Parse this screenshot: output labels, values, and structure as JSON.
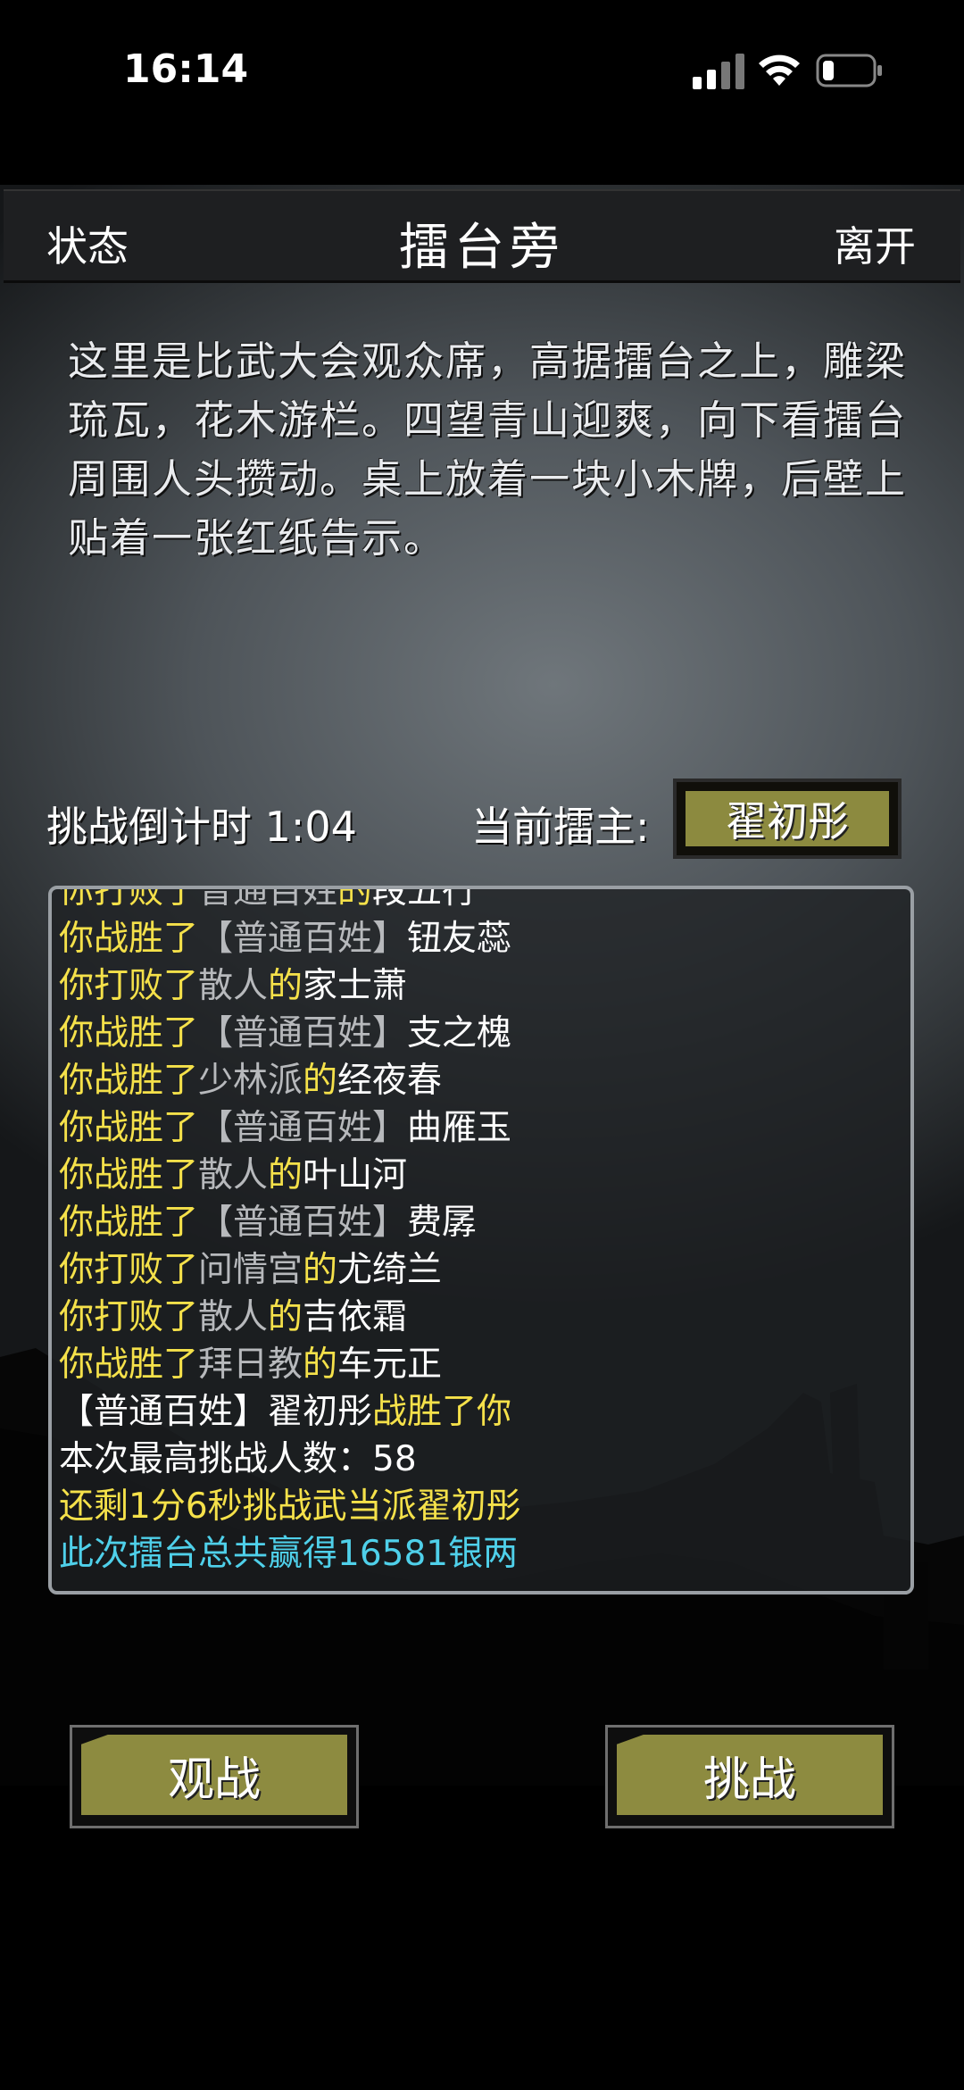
{
  "status_bar": {
    "time": "16:14"
  },
  "header": {
    "left": "状态",
    "title": "擂台旁",
    "right": "离开"
  },
  "description": "这里是比武大会观众席，高据擂台之上，雕梁琉瓦，花木游栏。四望青山迎爽，向下看擂台周围人头攒动。桌上放着一块小木牌，后壁上贴着一张红纸告示。",
  "countdown": {
    "label": "挑战倒计时 1:04"
  },
  "champion": {
    "label": "当前擂主:",
    "name": "翟初彤"
  },
  "log": [
    [
      {
        "t": "你打败了",
        "c": "y"
      },
      {
        "t": "普通百姓",
        "c": "g"
      },
      {
        "t": "的",
        "c": "y"
      },
      {
        "t": "段五行",
        "c": "w"
      }
    ],
    [
      {
        "t": "你战胜了",
        "c": "y"
      },
      {
        "t": "【普通百姓】",
        "c": "g"
      },
      {
        "t": "钮友蕊",
        "c": "w"
      }
    ],
    [
      {
        "t": "你打败了",
        "c": "y"
      },
      {
        "t": "散人",
        "c": "g"
      },
      {
        "t": "的",
        "c": "y"
      },
      {
        "t": "家士萧",
        "c": "w"
      }
    ],
    [
      {
        "t": "你战胜了",
        "c": "y"
      },
      {
        "t": "【普通百姓】",
        "c": "g"
      },
      {
        "t": "支之槐",
        "c": "w"
      }
    ],
    [
      {
        "t": "你战胜了",
        "c": "y"
      },
      {
        "t": "少林派",
        "c": "g"
      },
      {
        "t": "的",
        "c": "y"
      },
      {
        "t": "经夜春",
        "c": "w"
      }
    ],
    [
      {
        "t": "你战胜了",
        "c": "y"
      },
      {
        "t": "【普通百姓】",
        "c": "g"
      },
      {
        "t": "曲雁玉",
        "c": "w"
      }
    ],
    [
      {
        "t": "你战胜了",
        "c": "y"
      },
      {
        "t": "散人",
        "c": "g"
      },
      {
        "t": "的",
        "c": "y"
      },
      {
        "t": "叶山河",
        "c": "w"
      }
    ],
    [
      {
        "t": "你战胜了",
        "c": "y"
      },
      {
        "t": "【普通百姓】",
        "c": "g"
      },
      {
        "t": "费孱",
        "c": "w"
      }
    ],
    [
      {
        "t": "你打败了",
        "c": "y"
      },
      {
        "t": "问情宫",
        "c": "g"
      },
      {
        "t": "的",
        "c": "y"
      },
      {
        "t": "尤绮兰",
        "c": "w"
      }
    ],
    [
      {
        "t": "你打败了",
        "c": "y"
      },
      {
        "t": "散人",
        "c": "g"
      },
      {
        "t": "的",
        "c": "y"
      },
      {
        "t": "吉依霜",
        "c": "w"
      }
    ],
    [
      {
        "t": "你战胜了",
        "c": "y"
      },
      {
        "t": "拜日教",
        "c": "g"
      },
      {
        "t": "的",
        "c": "y"
      },
      {
        "t": "车元正",
        "c": "w"
      }
    ],
    [
      {
        "t": "【普通百姓】",
        "c": "w"
      },
      {
        "t": "翟初彤",
        "c": "w"
      },
      {
        "t": "战胜了你",
        "c": "y"
      }
    ],
    [
      {
        "t": "本次最高挑战人数：58",
        "c": "w"
      }
    ],
    [
      {
        "t": "还剩1分6秒挑战武当派翟初彤",
        "c": "y"
      }
    ],
    [
      {
        "t": "此次擂台总共赢得16581银两",
        "c": "c"
      }
    ]
  ],
  "buttons": {
    "watch": "观战",
    "challenge": "挑战"
  }
}
